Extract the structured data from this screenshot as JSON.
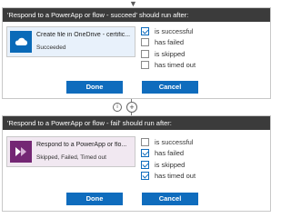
{
  "top_arrow_glyph": "▼",
  "panels": [
    {
      "header": "'Respond to a PowerApp or flow - succeed' should run after:",
      "action": {
        "title": "Create file in OneDrive - certific...",
        "status": "Succeeded",
        "icon": "onedrive-cloud-icon",
        "icon_color": "#0a6ab8"
      },
      "options": [
        {
          "label": "is successful",
          "checked": true
        },
        {
          "label": "has failed",
          "checked": false
        },
        {
          "label": "is skipped",
          "checked": false
        },
        {
          "label": "has timed out",
          "checked": false
        }
      ],
      "done_label": "Done",
      "cancel_label": "Cancel"
    },
    {
      "header": "'Respond to a PowerApp or flow - fail' should run after:",
      "action": {
        "title": "Respond to a PowerApp or flo...",
        "status": "Skipped, Failed, Timed out",
        "icon": "powerapps-icon",
        "icon_color": "#742774"
      },
      "options": [
        {
          "label": "is successful",
          "checked": false
        },
        {
          "label": "has failed",
          "checked": true
        },
        {
          "label": "is skipped",
          "checked": true
        },
        {
          "label": "has timed out",
          "checked": true
        }
      ],
      "done_label": "Done",
      "cancel_label": "Cancel"
    }
  ],
  "connector": {
    "info_glyph": "i",
    "plus_glyph": "+"
  },
  "colors": {
    "header_bg": "#3b3b3b",
    "button": "#0f6cbd"
  }
}
